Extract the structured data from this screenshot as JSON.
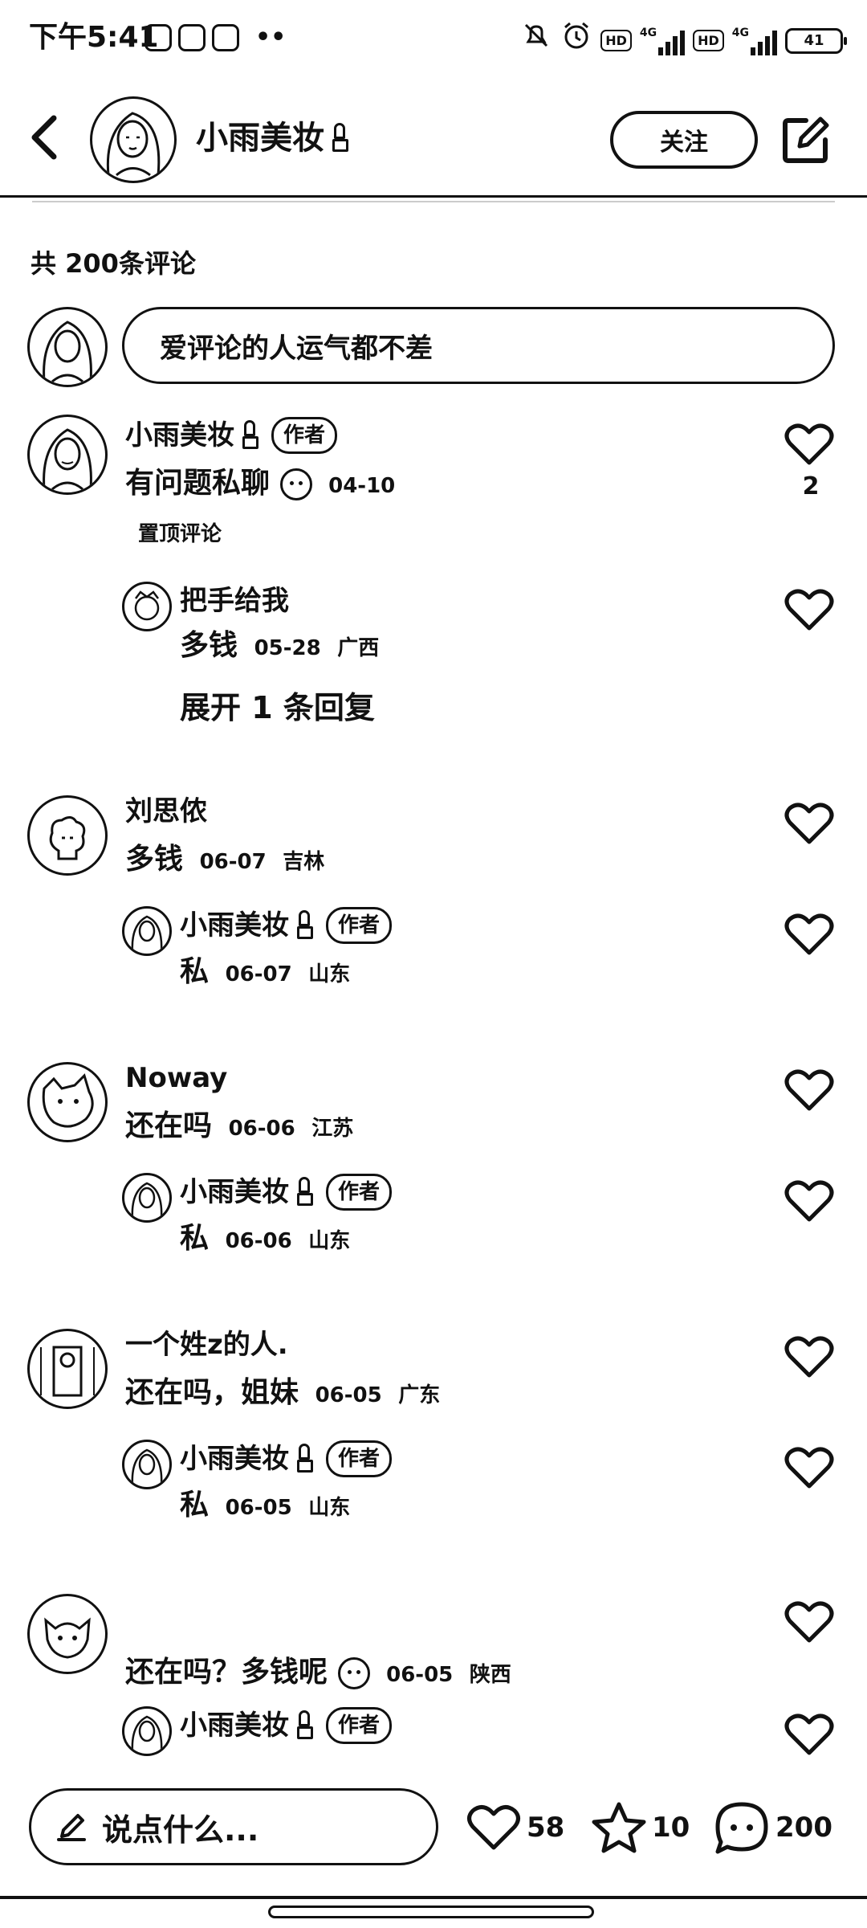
{
  "status_bar": {
    "time": "下午5:41",
    "dots": "••",
    "network_4g_1": "4G",
    "network_4g_2": "4G",
    "hd": "HD",
    "battery": "41"
  },
  "header": {
    "back_icon": "chevron-left-icon",
    "name": "小雨美妆",
    "follow_label": "关注",
    "edit_icon": "edit-icon"
  },
  "comments_header": {
    "total": "共 200条评论",
    "input_placeholder": "爱评论的人运气都不差"
  },
  "comments": [
    {
      "name": "小雨美妆",
      "author_tag": "作者",
      "text": "有问题私聊",
      "date": "04-10",
      "region": "",
      "pinned": "置顶评论",
      "likes": "2",
      "replies": [
        {
          "name": "把手给我",
          "text": "多钱",
          "date": "05-28",
          "region": "广西"
        }
      ],
      "expand": "展开 1 条回复"
    },
    {
      "name": "刘思侬",
      "text": "多钱",
      "date": "06-07",
      "region": "吉林",
      "replies": [
        {
          "name": "小雨美妆",
          "author_tag": "作者",
          "text": "私",
          "date": "06-07",
          "region": "山东"
        }
      ]
    },
    {
      "name": "Noway",
      "text": "还在吗",
      "date": "06-06",
      "region": "江苏",
      "replies": [
        {
          "name": "小雨美妆",
          "author_tag": "作者",
          "text": "私",
          "date": "06-06",
          "region": "山东"
        }
      ]
    },
    {
      "name": "一个姓z的人.",
      "text": "还在吗，姐妹",
      "date": "06-05",
      "region": "广东",
      "replies": [
        {
          "name": "小雨美妆",
          "author_tag": "作者",
          "text": "私",
          "date": "06-05",
          "region": "山东"
        }
      ]
    },
    {
      "name": "",
      "text": "还在吗？多钱呢",
      "date": "06-05",
      "region": "陕西",
      "replies": [
        {
          "name": "小雨美妆",
          "author_tag": "作者"
        }
      ]
    }
  ],
  "bottom_bar": {
    "say_placeholder": "说点什么...",
    "likes": "58",
    "stars": "10",
    "comments": "200"
  }
}
